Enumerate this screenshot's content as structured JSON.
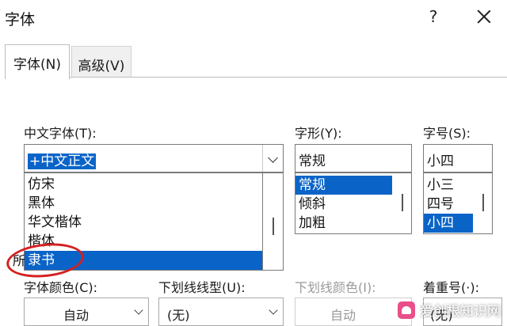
{
  "dialog": {
    "title": "字体",
    "help": "?"
  },
  "tabs": [
    {
      "label": "字体(N)",
      "active": true
    },
    {
      "label": "高级(V)",
      "active": false
    }
  ],
  "chinese_font": {
    "label": "中文字体(T):",
    "value": "+中文正文",
    "list": [
      "仿宋",
      "黑体",
      "华文楷体",
      "楷体",
      "隶书"
    ],
    "selected": "隶书"
  },
  "font_style": {
    "label": "字形(Y):",
    "value": "常规",
    "list": [
      "常规",
      "倾斜",
      "加粗"
    ],
    "selected": "常规"
  },
  "font_size": {
    "label": "字号(S):",
    "value": "小四",
    "list": [
      "小三",
      "四号",
      "小四"
    ],
    "selected": "小四"
  },
  "partial_section_label": "所",
  "bottom": {
    "font_color_label": "字体颜色(C):",
    "font_color_value": "自动",
    "underline_style_label": "下划线线型(U):",
    "underline_style_value": "(无)",
    "underline_color_label": "下划线颜色(I):",
    "underline_color_value": "自动",
    "emphasis_label": "着重号(·):",
    "emphasis_value": "(无)"
  },
  "watermark_text": "爱创根知识网",
  "colors": {
    "selection": "#0a64c8",
    "annotation": "#d42020"
  }
}
